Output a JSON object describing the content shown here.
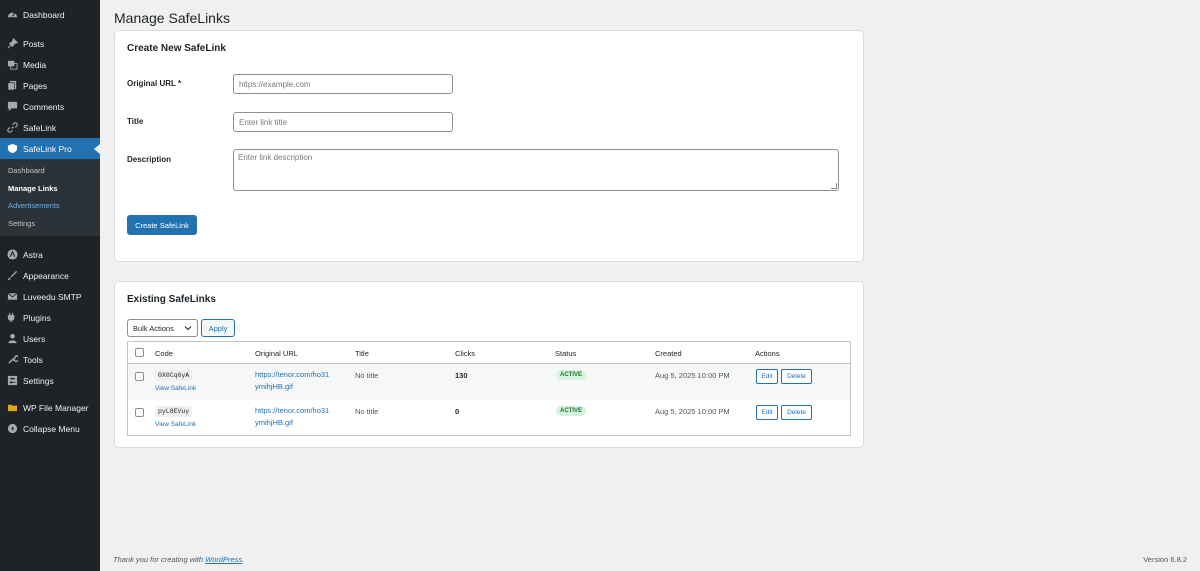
{
  "sidebar": {
    "items": [
      {
        "label": "Dashboard",
        "icon": "dashboard-icon"
      },
      {
        "label": "Posts",
        "icon": "pin-icon"
      },
      {
        "label": "Media",
        "icon": "media-icon"
      },
      {
        "label": "Pages",
        "icon": "pages-icon"
      },
      {
        "label": "Comments",
        "icon": "comments-icon"
      },
      {
        "label": "SafeLink",
        "icon": "link-icon"
      },
      {
        "label": "SafeLink Pro",
        "icon": "shield-icon"
      },
      {
        "label": "Astra",
        "icon": "astra-icon"
      },
      {
        "label": "Appearance",
        "icon": "appearance-icon"
      },
      {
        "label": "Luveedu SMTP",
        "icon": "mail-icon"
      },
      {
        "label": "Plugins",
        "icon": "plugins-icon"
      },
      {
        "label": "Users",
        "icon": "users-icon"
      },
      {
        "label": "Tools",
        "icon": "tools-icon"
      },
      {
        "label": "Settings",
        "icon": "settings-icon"
      },
      {
        "label": "WP File Manager",
        "icon": "file-manager-icon"
      },
      {
        "label": "Collapse Menu",
        "icon": "collapse-icon"
      }
    ],
    "submenu": [
      "Dashboard",
      "Manage Links",
      "Advertisements",
      "Settings"
    ]
  },
  "page": {
    "title": "Manage SafeLinks"
  },
  "create": {
    "heading": "Create New SafeLink",
    "url_label": "Original URL *",
    "url_placeholder": "https://example.com",
    "title_label": "Title",
    "title_placeholder": "Enter link title",
    "desc_label": "Description",
    "desc_placeholder": "Enter link description",
    "submit_label": "Create SafeLink"
  },
  "existing": {
    "heading": "Existing SafeLinks",
    "bulk_label": "Bulk Actions",
    "apply_label": "Apply",
    "columns": [
      "Code",
      "Original URL",
      "Title",
      "Clicks",
      "Status",
      "Created",
      "Actions"
    ],
    "rows": [
      {
        "code": "0X0Cq6yA",
        "view": "View SafeLink",
        "url1": "https://tenor.com/ho31",
        "url2": "ymihjHB.gif",
        "title": "No title",
        "clicks": "130",
        "status": "ACTIVE",
        "created": "Aug 5, 2025 10:00 PM",
        "edit": "Edit",
        "delete": "Delete"
      },
      {
        "code": "pyL8EVuy",
        "view": "View SafeLink",
        "url1": "https://tenor.com/ho31",
        "url2": "ymihjHB.gif",
        "title": "No title",
        "clicks": "0",
        "status": "ACTIVE",
        "created": "Aug 5, 2025 10:00 PM",
        "edit": "Edit",
        "delete": "Delete"
      }
    ]
  },
  "footer": {
    "thanks": "Thank you for creating with",
    "wp": "WordPress",
    "dot": ".",
    "version": "Version 6.8.2"
  },
  "colors": {
    "accent": "#2271b1",
    "sidebar": "#1d2327",
    "status_bg": "#d7f2dd",
    "status_fg": "#1a7431"
  }
}
